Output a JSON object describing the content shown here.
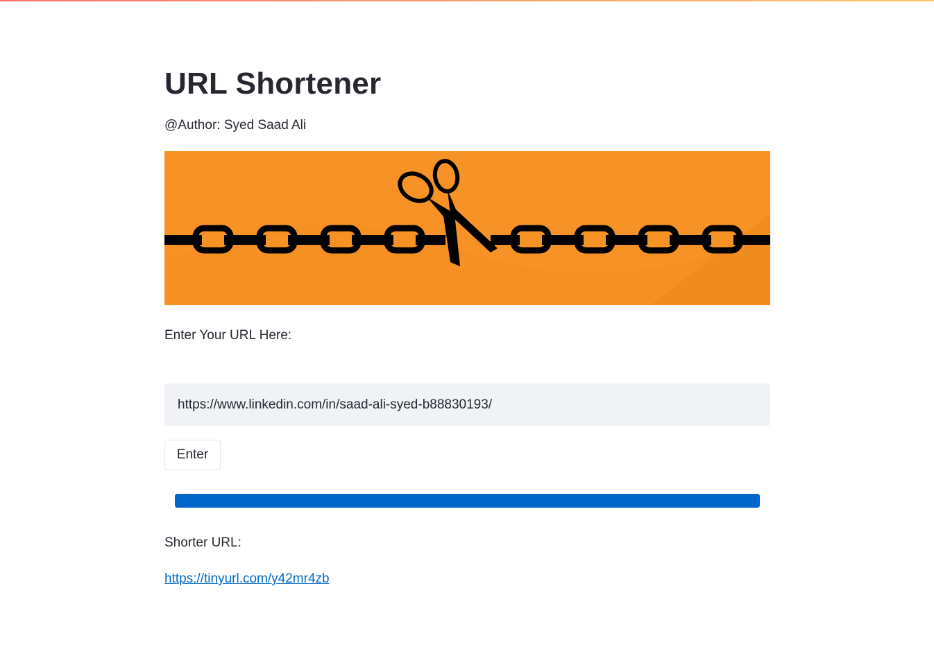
{
  "app": {
    "title": "URL Shortener",
    "author_line": "@Author: Syed Saad Ali"
  },
  "banner": {
    "description_icon": "chain-cut-by-scissors-image",
    "background_color": "#f79226"
  },
  "form": {
    "prompt_label": "Enter Your URL Here:",
    "url_value": "https://www.linkedin.com/in/saad-ali-syed-b88830193/",
    "enter_button_label": "Enter"
  },
  "progress": {
    "percent": 100,
    "color": "#0066cc"
  },
  "result": {
    "label": "Shorter URL:",
    "short_url": "https://tinyurl.com/y42mr4zb"
  },
  "colors": {
    "text": "#262730",
    "link": "#0068c9",
    "input_bg": "#f0f2f6"
  }
}
